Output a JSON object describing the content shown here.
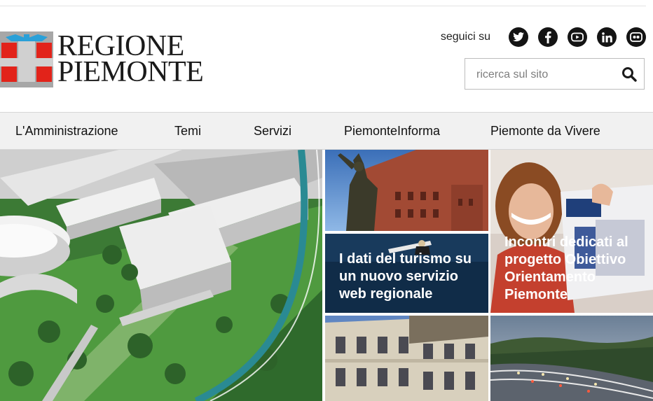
{
  "brand": {
    "line1": "REGIONE",
    "line2": "PIEMONTE"
  },
  "social": {
    "label": "seguici su",
    "icons": [
      "twitter-icon",
      "facebook-icon",
      "youtube-icon",
      "linkedin-icon",
      "flickr-icon"
    ]
  },
  "search": {
    "placeholder": "ricerca sul sito",
    "value": ""
  },
  "nav": {
    "items": [
      {
        "label": "L'Amministrazione"
      },
      {
        "label": "Temi"
      },
      {
        "label": "Servizi"
      },
      {
        "label": "PiemonteInforma"
      },
      {
        "label": "Piemonte da Vivere"
      }
    ]
  },
  "tiles": {
    "turismo": {
      "caption": "I dati del turismo su un nuovo servizio web regionale"
    },
    "orientamento": {
      "caption": "Incontri dedicati al progetto Obiettivo Orientamento Piemonte"
    }
  },
  "colors": {
    "logo_red": "#e2231a",
    "nav_bg": "#f1f1f1",
    "accent_teal": "#2a8a93",
    "dark_tile": "#0f2a45"
  }
}
